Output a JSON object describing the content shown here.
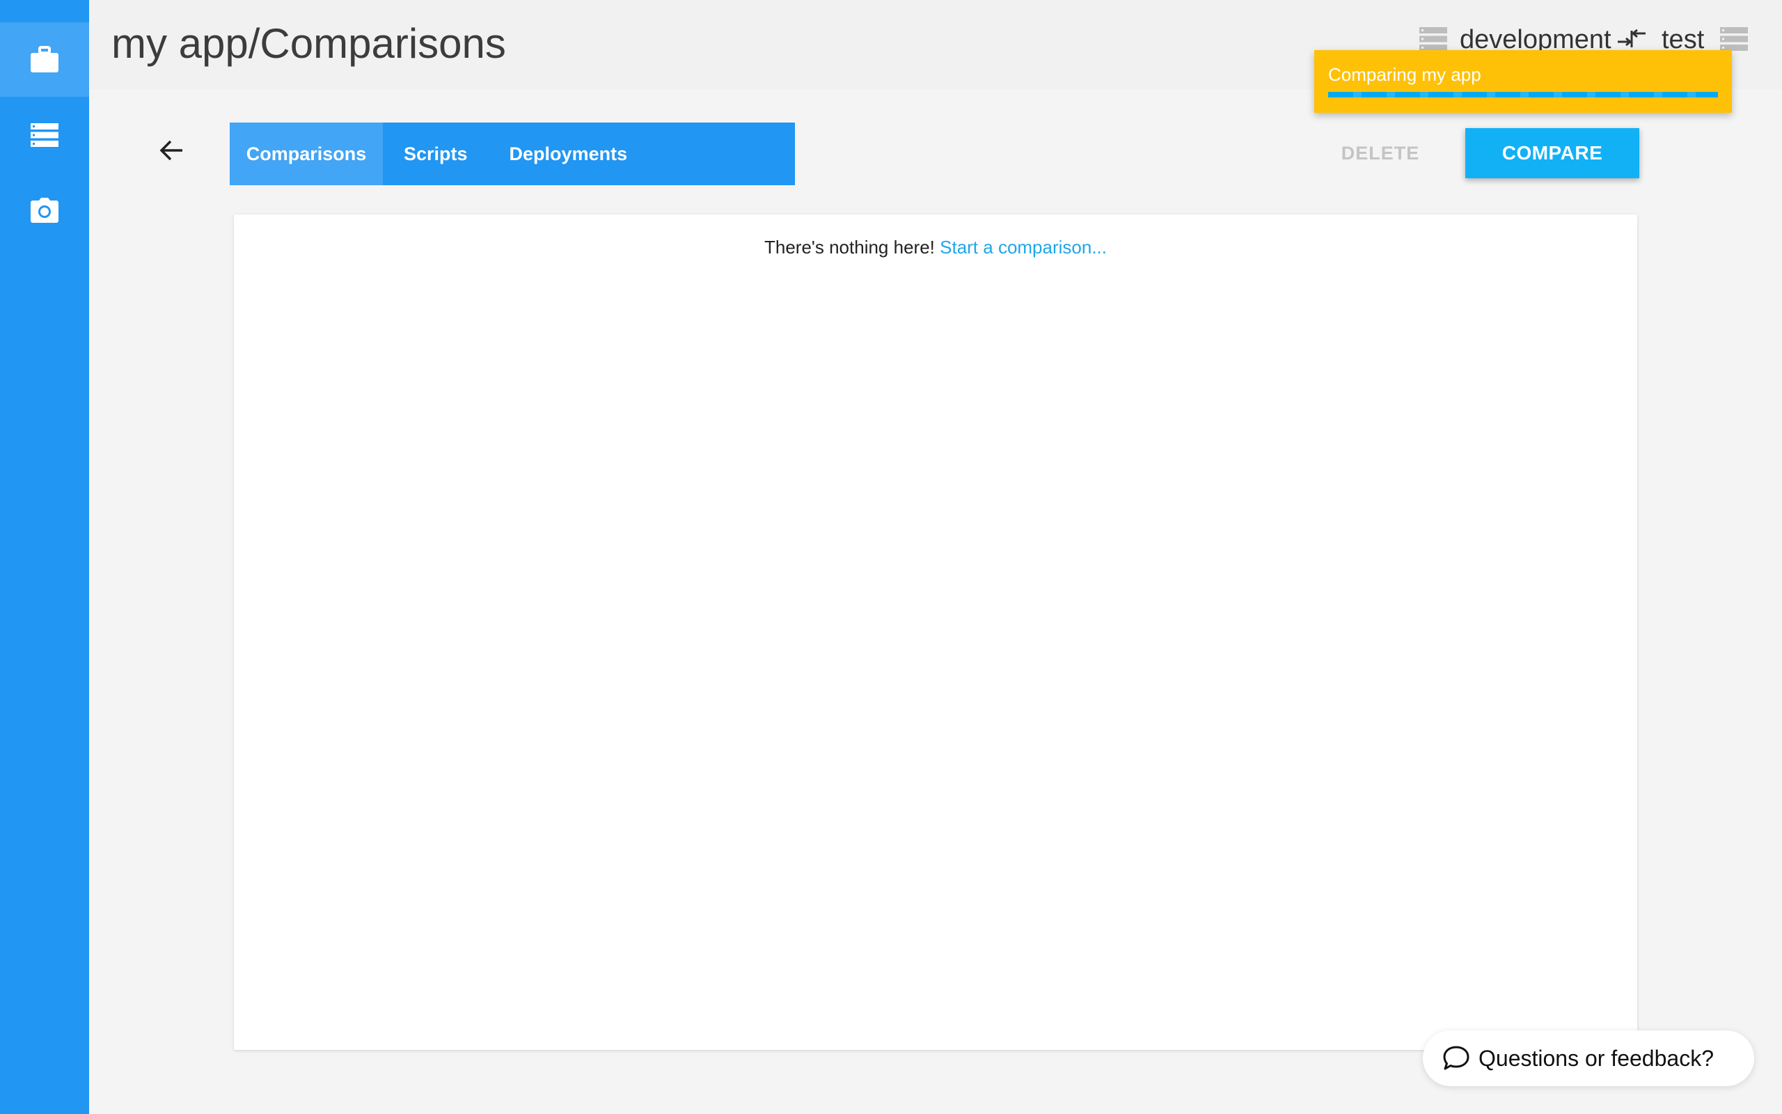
{
  "sidebar": {
    "items": [
      {
        "icon": "briefcase-icon",
        "active": true
      },
      {
        "icon": "server-list-icon",
        "active": false
      },
      {
        "icon": "camera-icon",
        "active": false
      }
    ]
  },
  "header": {
    "title": "my app/Comparisons",
    "source_env": "development",
    "target_env": "test"
  },
  "toast": {
    "message": "Comparing my app",
    "color": "#ffc107"
  },
  "tabs": [
    {
      "label": "Comparisons",
      "active": true
    },
    {
      "label": "Scripts",
      "active": false
    },
    {
      "label": "Deployments",
      "active": false
    }
  ],
  "actions": {
    "delete_label": "DELETE",
    "compare_label": "COMPARE"
  },
  "content": {
    "empty_text": "There's nothing here!",
    "empty_link": "Start a comparison..."
  },
  "feedback": {
    "label": "Questions or feedback?"
  },
  "colors": {
    "primary": "#2196f3",
    "accent": "#12b1f6",
    "warning": "#ffc107"
  }
}
